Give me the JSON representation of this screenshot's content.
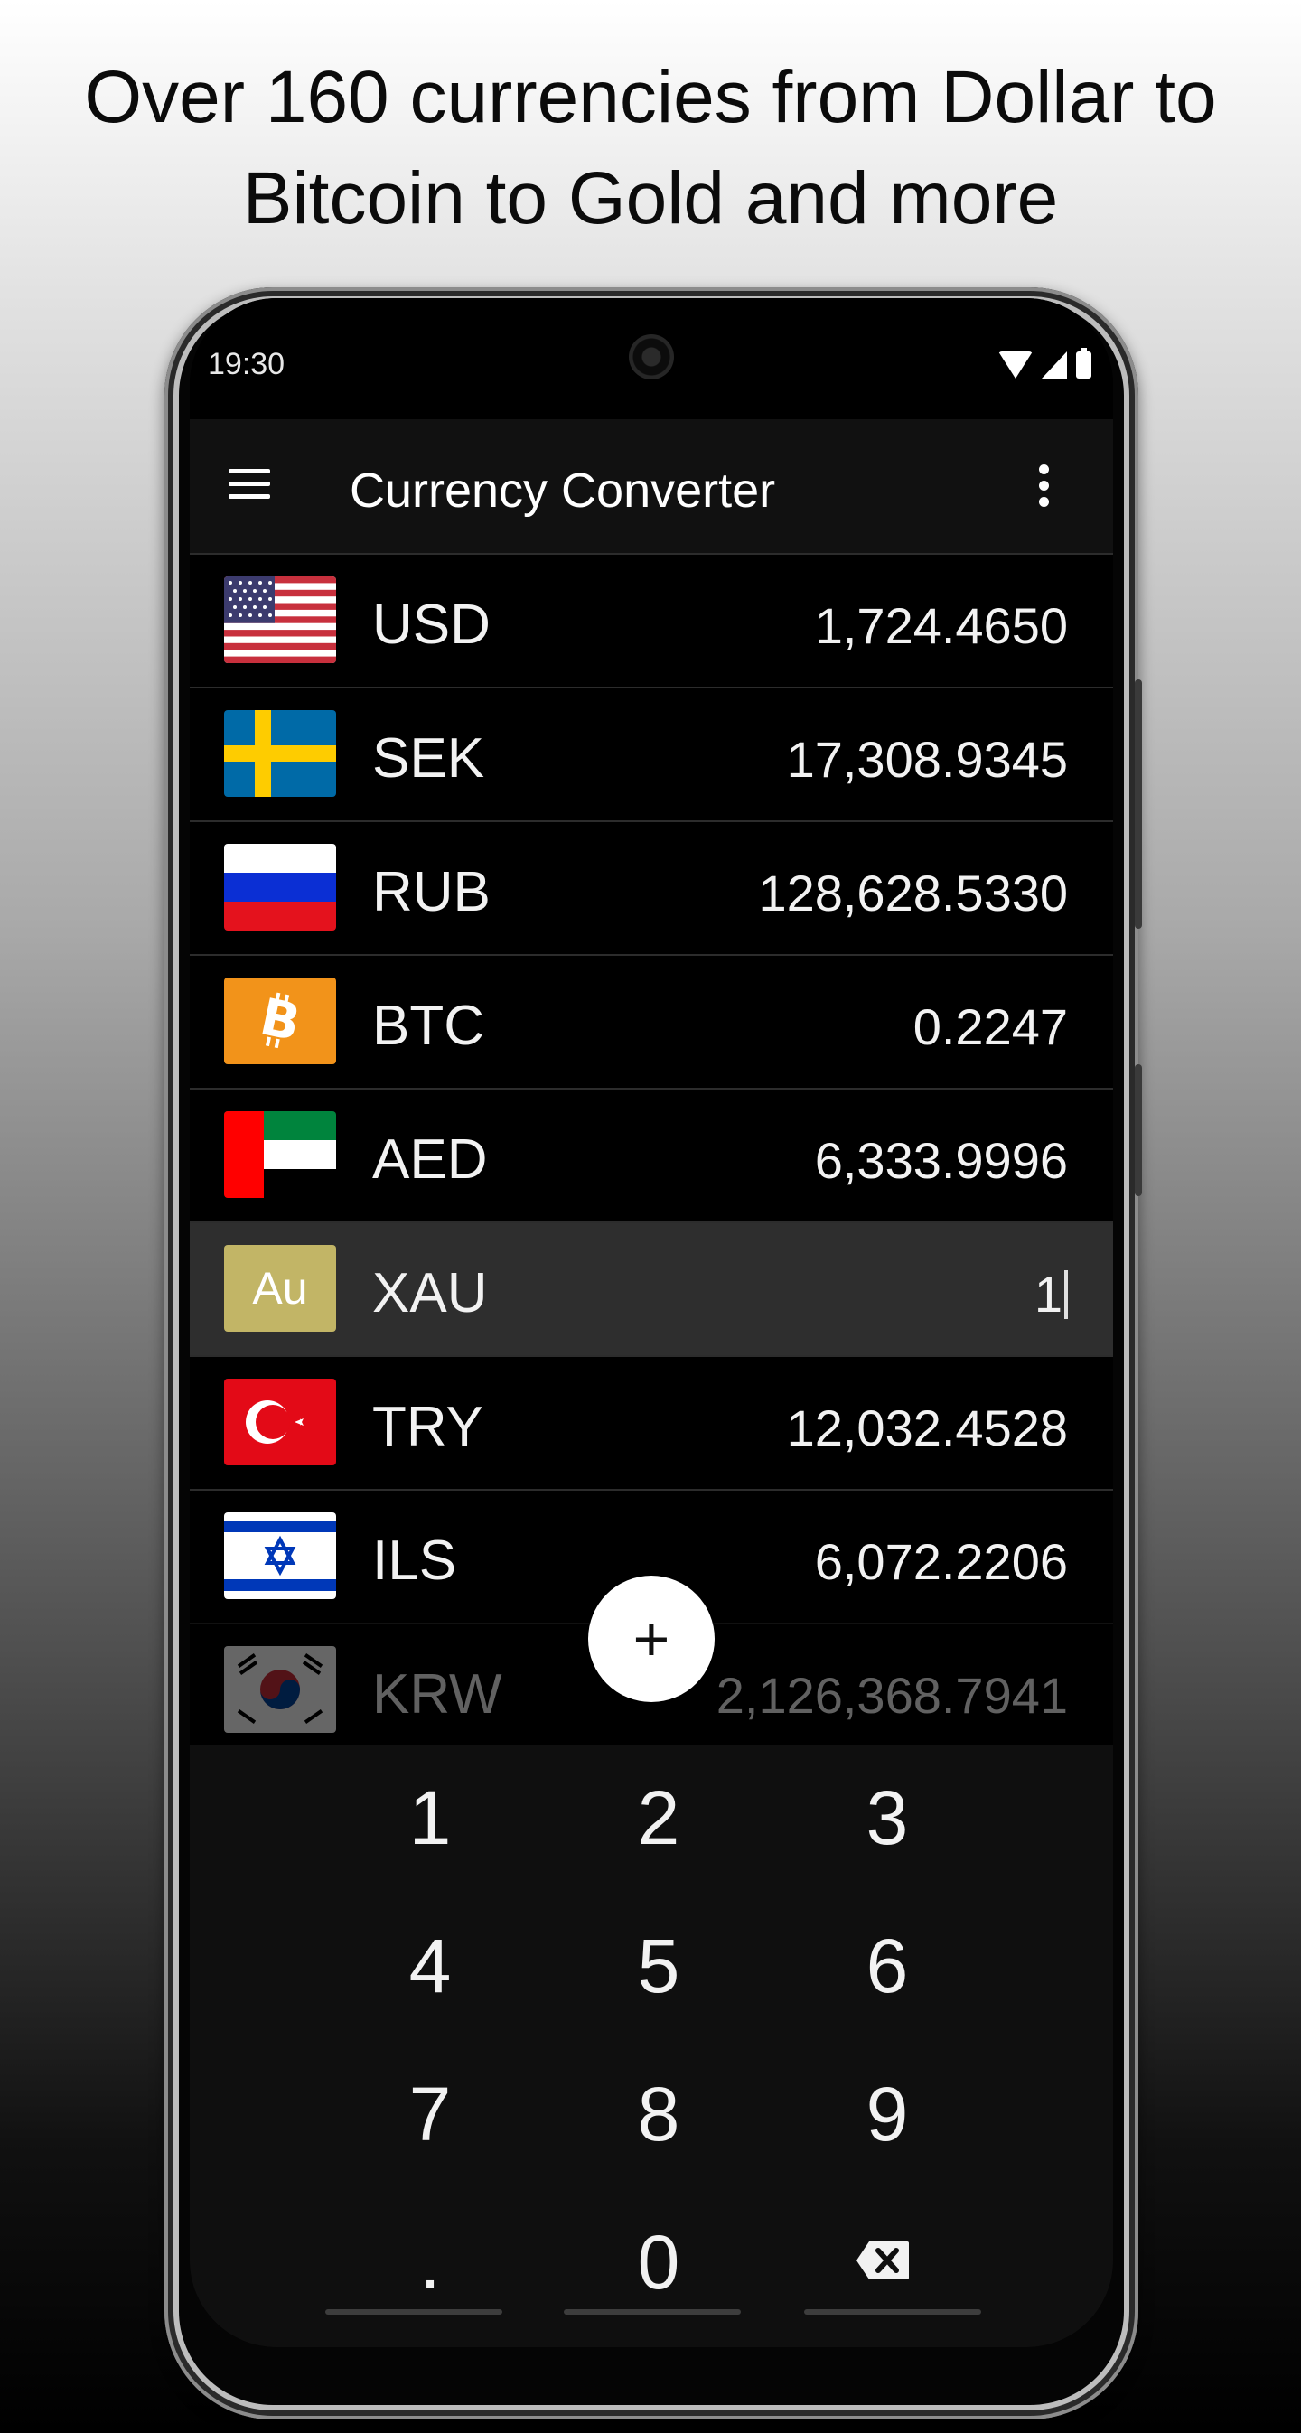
{
  "headline": {
    "line1": "Over 160 currencies from Dollar to",
    "line2": "Bitcoin to Gold and more"
  },
  "status_bar": {
    "time": "19:30",
    "icons": [
      "wifi-icon",
      "signal-icon",
      "battery-icon"
    ]
  },
  "app_bar": {
    "title": "Currency Converter",
    "menu_icon": "hamburger-menu-icon",
    "overflow_icon": "more-vertical-icon"
  },
  "currencies": [
    {
      "code": "USD",
      "value": "1,724.4650",
      "flag": "us-flag-icon"
    },
    {
      "code": "SEK",
      "value": "17,308.9345",
      "flag": "sweden-flag-icon"
    },
    {
      "code": "RUB",
      "value": "128,628.5330",
      "flag": "russia-flag-icon"
    },
    {
      "code": "BTC",
      "value": "0.2247",
      "flag": "bitcoin-icon"
    },
    {
      "code": "AED",
      "value": "6,333.9996",
      "flag": "uae-flag-icon"
    },
    {
      "code": "XAU",
      "value": "1",
      "flag": "gold-icon",
      "flag_text": "Au",
      "selected": true
    },
    {
      "code": "TRY",
      "value": "12,032.4528",
      "flag": "turkey-flag-icon"
    },
    {
      "code": "ILS",
      "value": "6,072.2206",
      "flag": "israel-flag-icon"
    },
    {
      "code": "KRW",
      "value": "2,126,368.7941",
      "flag": "south-korea-flag-icon"
    }
  ],
  "fab": {
    "label": "+",
    "icon": "plus-icon"
  },
  "keypad": {
    "keys": [
      "1",
      "2",
      "3",
      "4",
      "5",
      "6",
      "7",
      "8",
      "9",
      ".",
      "0"
    ],
    "backspace_icon": "backspace-icon"
  },
  "colors": {
    "screen_bg": "#000000",
    "app_bar_bg": "#111111",
    "selected_row_bg": "#2e2e2e",
    "bitcoin_orange": "#f2931a",
    "gold": "#c2b566"
  }
}
